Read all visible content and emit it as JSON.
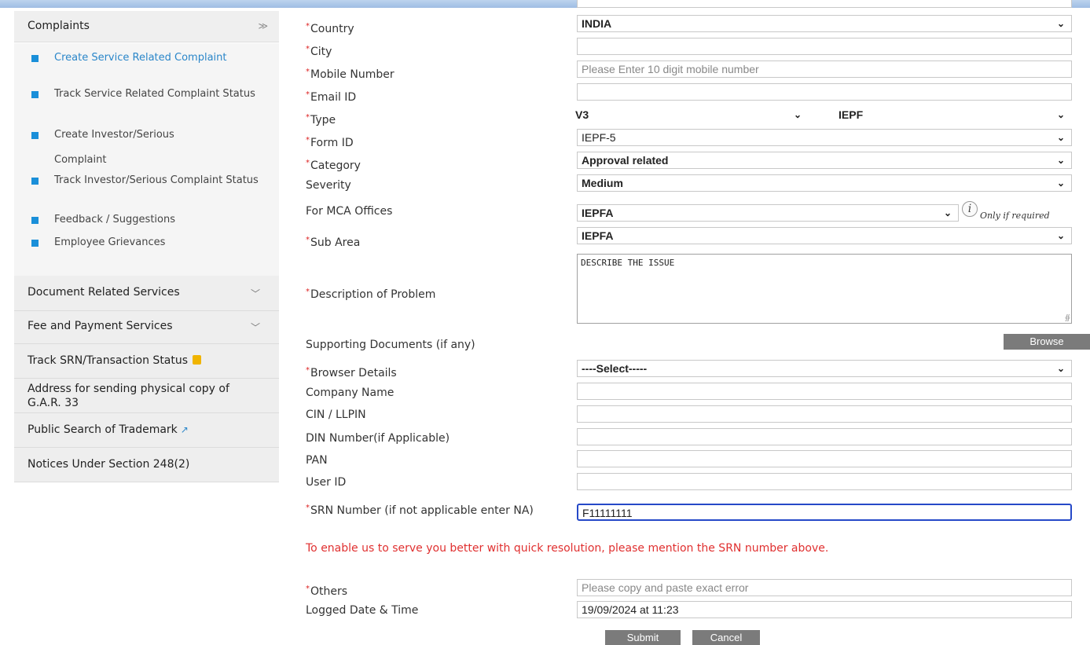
{
  "sidebar": {
    "header": "Complaints",
    "items": [
      {
        "label": "Create Service Related Complaint",
        "active": true
      },
      {
        "label": "Track Service Related Complaint Status"
      },
      {
        "label": "Create Investor/Serious"
      },
      {
        "label": "Complaint"
      },
      {
        "label": "Track Investor/Serious Complaint Status"
      },
      {
        "label": "Feedback / Suggestions"
      },
      {
        "label": "Employee Grievances"
      }
    ],
    "sections": [
      "Document Related Services",
      "Fee and Payment Services",
      "Track SRN/Transaction Status",
      "Address for sending physical copy of G.A.R. 33",
      "Public Search of Trademark",
      "Notices Under Section 248(2)"
    ]
  },
  "form": {
    "country": {
      "label": "Country",
      "value": "INDIA"
    },
    "city": {
      "label": "City",
      "value": ""
    },
    "mobile": {
      "label": "Mobile Number",
      "placeholder": "Please Enter 10 digit mobile number"
    },
    "email": {
      "label": "Email ID",
      "value": ""
    },
    "type": {
      "label": "Type",
      "value": "V3",
      "value2": "IEPF"
    },
    "form_id": {
      "label": "Form ID",
      "value": "IEPF-5"
    },
    "category": {
      "label": "Category",
      "value": "Approval related"
    },
    "severity": {
      "label": "Severity",
      "value": "Medium"
    },
    "mca_offices": {
      "label": "For MCA Offices",
      "value": "IEPFA",
      "note": "Only if required"
    },
    "sub_area": {
      "label": "Sub Area",
      "value": "IEPFA"
    },
    "description": {
      "label": "Description of Problem",
      "value": "DESCRIBE THE ISSUE"
    },
    "supporting": {
      "label": "Supporting Documents (if any)",
      "button": "Browse"
    },
    "browser": {
      "label": "Browser Details",
      "value": "----Select-----"
    },
    "company": {
      "label": "Company Name"
    },
    "cin": {
      "label": "CIN / LLPIN"
    },
    "din": {
      "label": "DIN Number(if Applicable)"
    },
    "pan": {
      "label": "PAN"
    },
    "user_id": {
      "label": "User ID"
    },
    "srn": {
      "label": "SRN Number (if not applicable enter NA)",
      "value": "F11111111"
    },
    "srn_note": "To enable us to serve you better with quick resolution, please mention the SRN number above.",
    "others": {
      "label": "Others",
      "placeholder": "Please copy and paste exact error"
    },
    "logged": {
      "label": "Logged Date & Time",
      "value": "19/09/2024 at 11:23"
    },
    "submit": "Submit",
    "cancel": "Cancel"
  },
  "colors": {
    "accent": "#1a8fd9",
    "required": "#dd2222",
    "warning_text": "#e03030",
    "focus": "#2649c8"
  }
}
